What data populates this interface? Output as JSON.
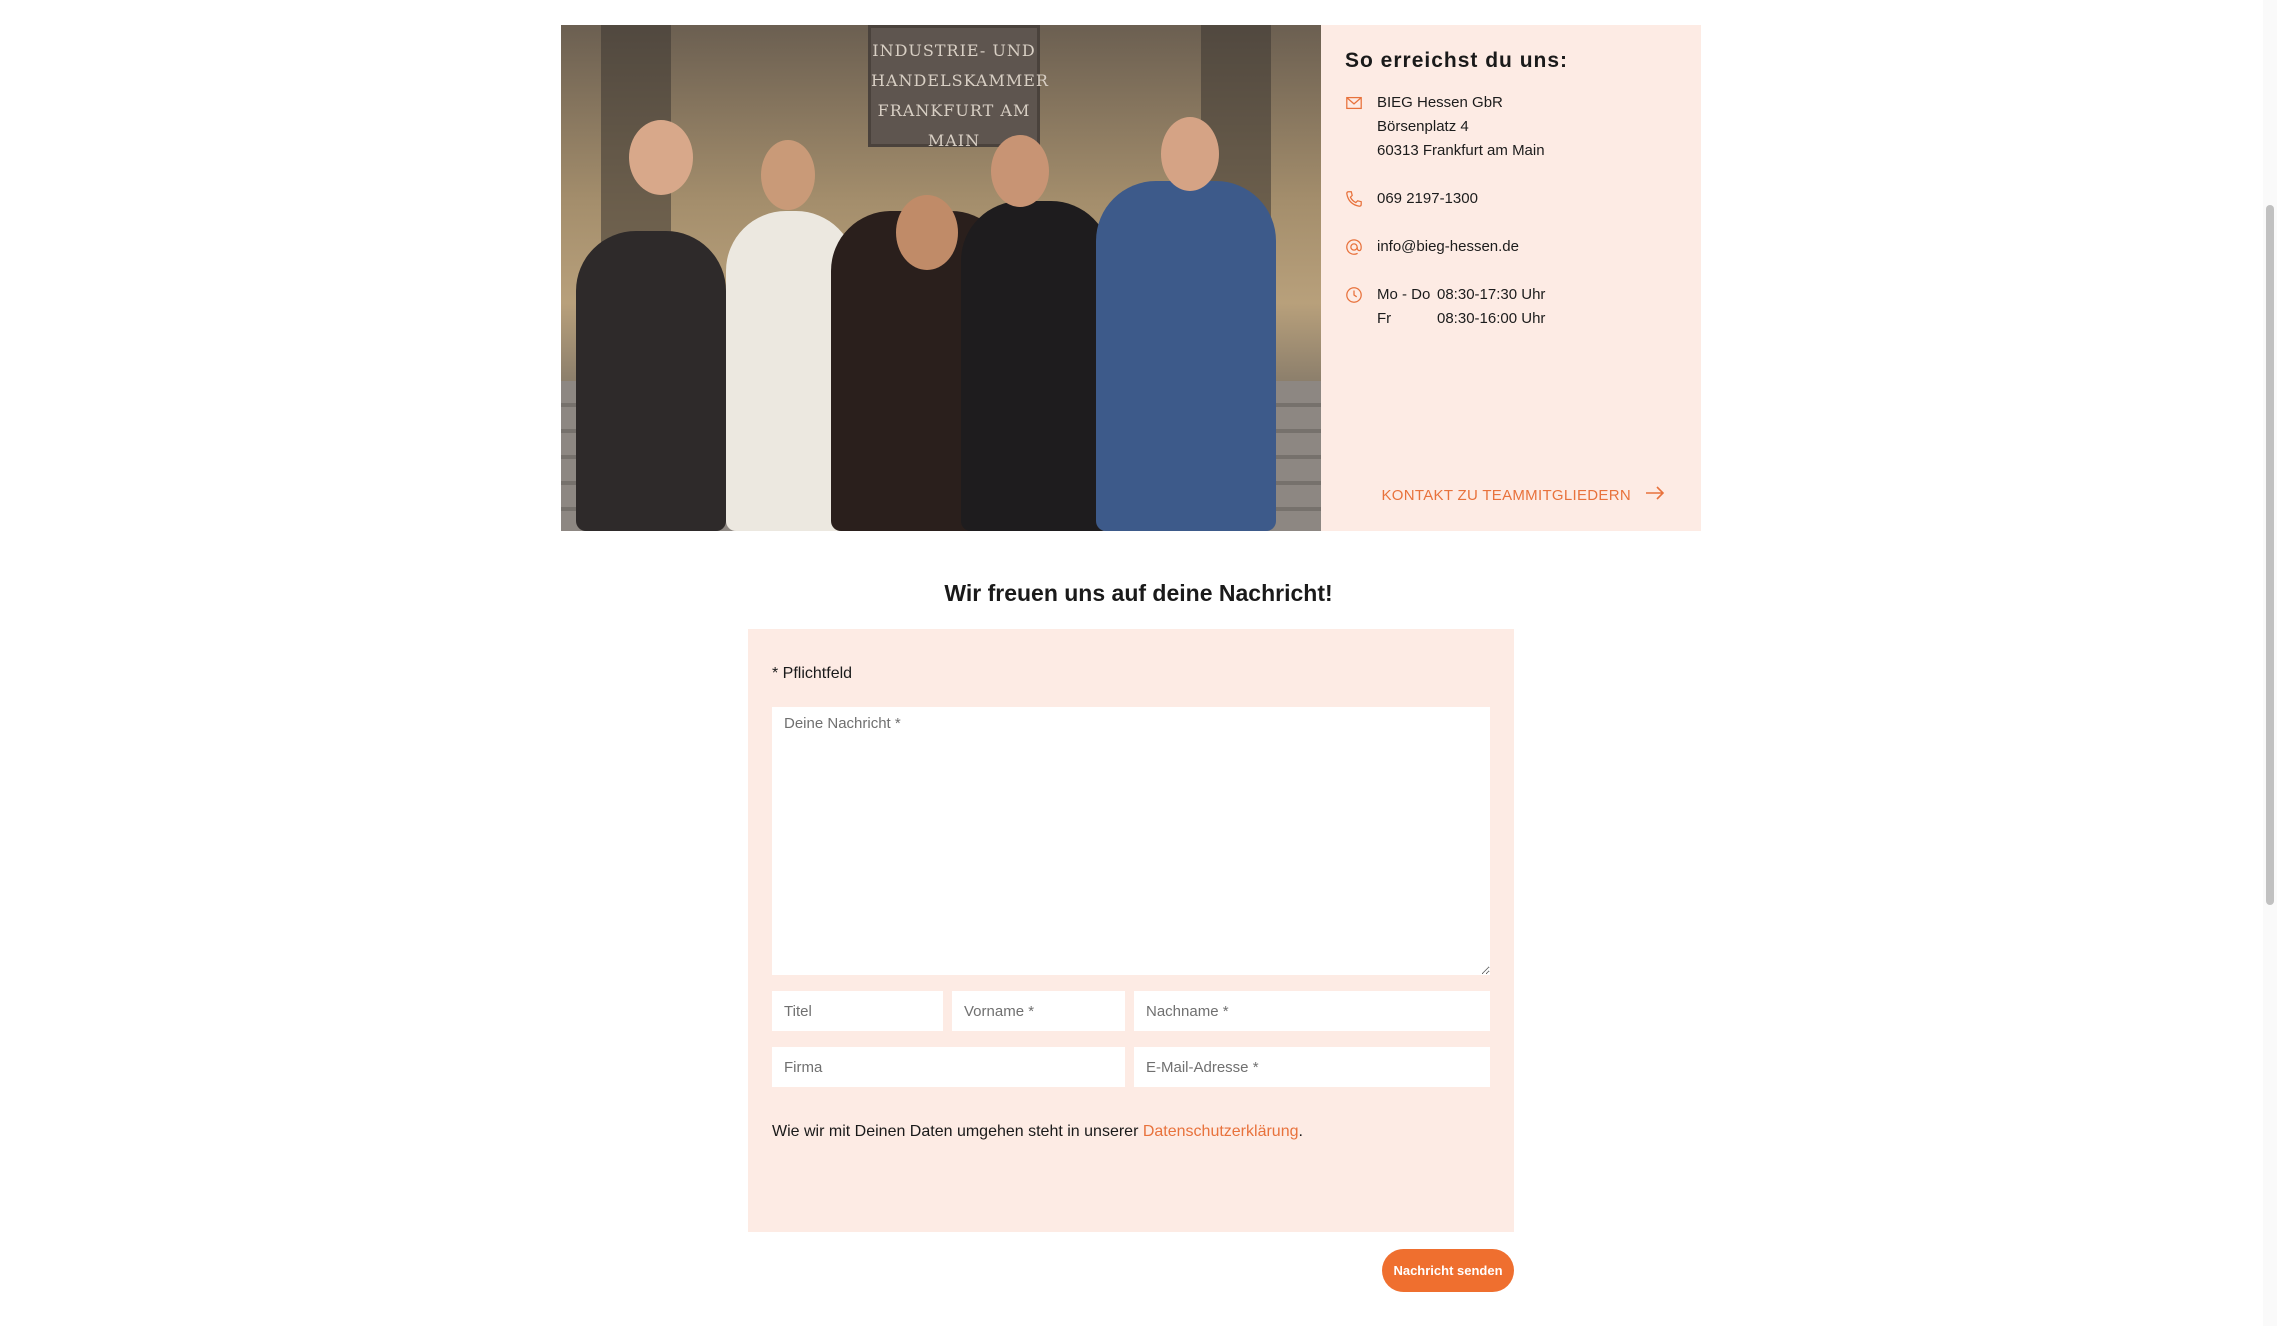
{
  "contact": {
    "heading": "So erreichst du uns:",
    "address": [
      "BIEG Hessen GbR",
      "Börsenplatz 4",
      "60313 Frankfurt am Main"
    ],
    "phone": "069 2197-1300",
    "email": "info@bieg-hessen.de",
    "hours": [
      {
        "days": "Mo - Do",
        "time": "08:30-17:30 Uhr"
      },
      {
        "days": "Fr",
        "time": "08:30-16:00 Uhr"
      }
    ],
    "team_link": "KONTAKT ZU TEAMMITGLIEDERN"
  },
  "photo": {
    "plaque_lines": [
      "INDUSTRIE- UND",
      "HANDELSKAMMER",
      "FRANKFURT AM MAIN"
    ]
  },
  "form": {
    "title": "Wir freuen uns auf deine Nachricht!",
    "required_note": "* Pflichtfeld",
    "message_placeholder": "Deine Nachricht *",
    "title_placeholder": "Titel",
    "firstname_placeholder": "Vorname *",
    "lastname_placeholder": "Nachname *",
    "company_placeholder": "Firma",
    "email_placeholder": "E-Mail-Adresse *",
    "privacy_text": "Wie wir mit Deinen Daten umgehen steht in unserer ",
    "privacy_link": "Datenschutzerklärung",
    "privacy_end": ".",
    "submit_label": "Nachricht senden"
  },
  "colors": {
    "accent": "#ef6f2f",
    "panel": "#fdebe4"
  },
  "icons": [
    "mail-icon",
    "phone-icon",
    "at-icon",
    "clock-icon",
    "arrow-right-icon"
  ]
}
